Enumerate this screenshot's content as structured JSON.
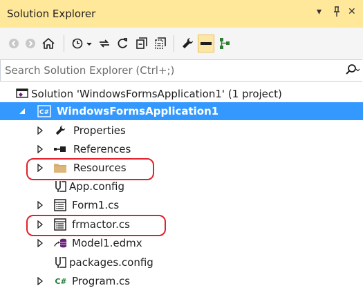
{
  "window": {
    "title": "Solution Explorer",
    "controls": {
      "dropdown": "▾",
      "pin": "ᛒ",
      "close": "✕"
    }
  },
  "toolbar": {
    "buttons": [
      {
        "name": "back",
        "icon": "back-arrow-icon"
      },
      {
        "name": "forward",
        "icon": "forward-arrow-icon"
      },
      {
        "name": "home",
        "icon": "home-icon"
      },
      {
        "name": "pending-changes",
        "icon": "clock-icon"
      },
      {
        "name": "sync",
        "icon": "sync-icon"
      },
      {
        "name": "refresh",
        "icon": "refresh-icon"
      },
      {
        "name": "collapse-all",
        "icon": "collapse-all-icon"
      },
      {
        "name": "show-all-files",
        "icon": "show-all-files-icon"
      },
      {
        "name": "properties",
        "icon": "wrench-icon"
      },
      {
        "name": "preview",
        "icon": "preview-icon"
      },
      {
        "name": "class-view",
        "icon": "class-diagram-icon"
      }
    ]
  },
  "search": {
    "placeholder": "Search Solution Explorer (Ctrl+;)",
    "value": ""
  },
  "tree": {
    "solution": {
      "label": "Solution 'WindowsFormsApplication1' (1 project)",
      "icon": "solution-icon"
    },
    "project": {
      "label": "WindowsFormsApplication1",
      "icon": "csharp-project-icon",
      "badge": "C#",
      "selected": true
    },
    "items": [
      {
        "label": "Properties",
        "icon": "wrench-icon",
        "expandable": true
      },
      {
        "label": "References",
        "icon": "references-icon",
        "expandable": true
      },
      {
        "label": "Resources",
        "icon": "folder-icon",
        "expandable": true,
        "highlighted": true
      },
      {
        "label": "App.config",
        "icon": "config-icon",
        "expandable": false
      },
      {
        "label": "Form1.cs",
        "icon": "form-icon",
        "expandable": true
      },
      {
        "label": "frmactor.cs",
        "icon": "form-icon",
        "expandable": true,
        "highlighted": true
      },
      {
        "label": "Model1.edmx",
        "icon": "edmx-icon",
        "expandable": true
      },
      {
        "label": "packages.config",
        "icon": "config-icon",
        "expandable": false
      },
      {
        "label": "Program.cs",
        "icon": "csharp-file-icon",
        "badge": "C#",
        "expandable": true
      }
    ]
  },
  "colors": {
    "title_bar": "#ffe89a",
    "selection": "#3399ff",
    "annotation": "#e0202a"
  }
}
